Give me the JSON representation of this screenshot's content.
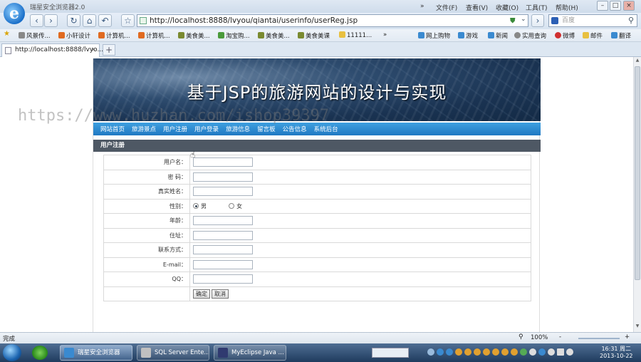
{
  "browser": {
    "title": "瑞星安全浏览器2.0",
    "menu": [
      "»",
      "文件(F)",
      "查看(V)",
      "收藏(O)",
      "工具(T)",
      "帮助(H)"
    ],
    "address": "http://localhost:8888/lvyou/qiantai/userinfo/userReg.jsp",
    "search_placeholder": "百度",
    "favorites": [
      "风景传...",
      "小轩设计",
      "计算机...",
      "计算机...",
      "美食美...",
      "淘宝购...",
      "美食美...",
      "美食美课",
      "11111...",
      "»",
      "网上购物",
      "游戏",
      "新闻",
      "实用查询",
      "微博",
      "邮件",
      "翻译"
    ],
    "tab_label": "http://localhost:8888/lvyo...",
    "tab_close": "×",
    "new_tab": "+",
    "status": "完成",
    "zoom": "100%"
  },
  "site": {
    "title": "基于JSP的旅游网站的设计与实现",
    "nav": [
      "网站首页",
      "旅游景点",
      "用户注册",
      "用户登录",
      "旅游信息",
      "留言板",
      "公告信息",
      "系统后台"
    ],
    "section": "用户注册",
    "form": {
      "fields": [
        "用户名：",
        "密 码：",
        "真实姓名：",
        "性别：",
        "年龄：",
        "住址：",
        "联系方式：",
        "E-mail：",
        "QQ："
      ],
      "gender_male": "男",
      "gender_female": "女",
      "submit": "确定",
      "cancel": "取消"
    }
  },
  "watermark": "https://www.huzhan.com/ishop39397",
  "taskbar": {
    "tasks": [
      "瑞星安全浏览器",
      "SQL Server Ente...",
      "MyEclipse Java ..."
    ],
    "time": "16:31 周二",
    "date": "2013-10-22"
  }
}
